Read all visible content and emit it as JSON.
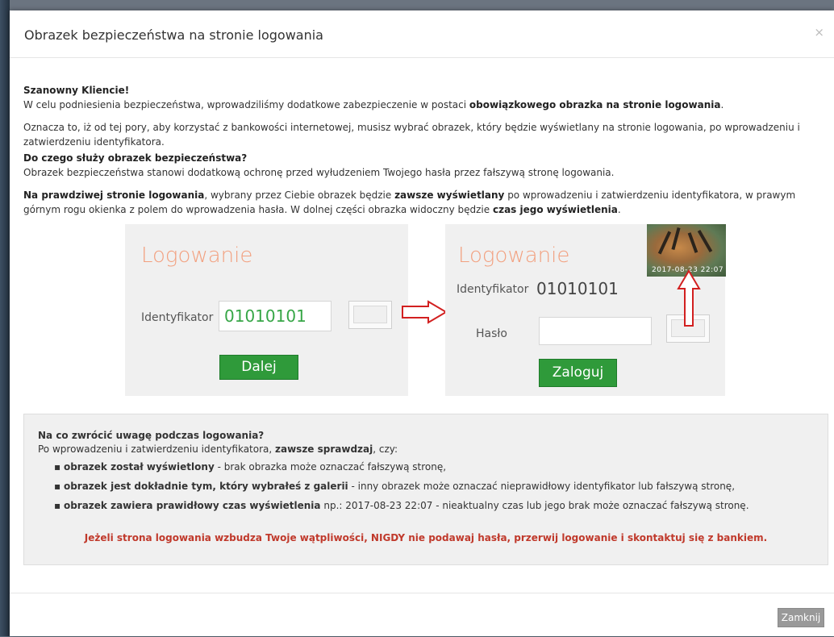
{
  "modal": {
    "title": "Obrazek bezpieczeństwa na stronie logowania",
    "close_glyph": "×"
  },
  "intro": {
    "greeting": "Szanowny Kliencie!",
    "line1_a": "W celu podniesienia bezpieczeństwa, wprowadziliśmy dodatkowe zabezpieczenie w postaci ",
    "line1_b": "obowiązkowego obrazka na stronie logowania",
    "line1_c": ".",
    "para2": "Oznacza to, iż od tej pory, aby korzystać z bankowości internetowej, musisz wybrać obrazek, który będzie wyświetlany na stronie logowania, po wprowadzeniu i zatwierdzeniu identyfikatora.",
    "q_title": "Do czego służy obrazek bezpieczeństwa?",
    "q_text": "Obrazek bezpieczeństwa stanowi dodatkową ochronę przed wyłudzeniem Twojego hasła przez fałszywą stronę logowania.",
    "p4_a": "Na prawdziwej stronie logowania",
    "p4_b": ", wybrany przez Ciebie obrazek będzie ",
    "p4_c": "zawsze wyświetlany",
    "p4_d": " po wprowadzeniu i zatwierdzeniu identyfikatora, w prawym górnym rogu okienka z polem do wprowadzenia hasła. W dolnej części obrazka widoczny będzie ",
    "p4_e": "czas jego wyświetlenia",
    "p4_f": "."
  },
  "figure_left": {
    "title": "Logowanie",
    "id_label": "Identyfikator",
    "id_value": "01010101",
    "button": "Dalej"
  },
  "figure_right": {
    "title": "Logowanie",
    "id_label": "Identyfikator",
    "id_value": "01010101",
    "pass_label": "Hasło",
    "button": "Zaloguj",
    "timestamp": "2017-08-23 22:07"
  },
  "notice": {
    "title": "Na co zwrócić uwagę podczas logowania?",
    "intro_a": "Po wprowadzeniu i zatwierdzeniu identyfikatora, ",
    "intro_b": "zawsze sprawdzaj",
    "intro_c": ", czy:",
    "items": [
      {
        "bold": "obrazek został wyświetlony",
        "rest": " - brak obrazka może oznaczać fałszywą stronę,"
      },
      {
        "bold": "obrazek jest dokładnie tym, który wybrałeś z galerii",
        "rest": " - inny obrazek może oznaczać nieprawidłowy identyfikator lub fałszywą stronę,"
      },
      {
        "bold": "obrazek zawiera prawidłowy czas wyświetlenia",
        "rest": " np.: 2017-08-23 22:07 - nieaktualny czas lub jego brak może oznaczać fałszywą stronę."
      }
    ],
    "warning": "Jeżeli strona logowania wzbudza Twoje wątpliwości, NIGDY nie podawaj hasła, przerwij logowanie i skontaktuj się z bankiem."
  },
  "footer": {
    "close_button": "Zamknij"
  },
  "colors": {
    "accent_green": "#2f9a3a",
    "warning_red": "#c0392b",
    "logo_orange": "#f2a07f",
    "arrow_red": "#d22020"
  }
}
